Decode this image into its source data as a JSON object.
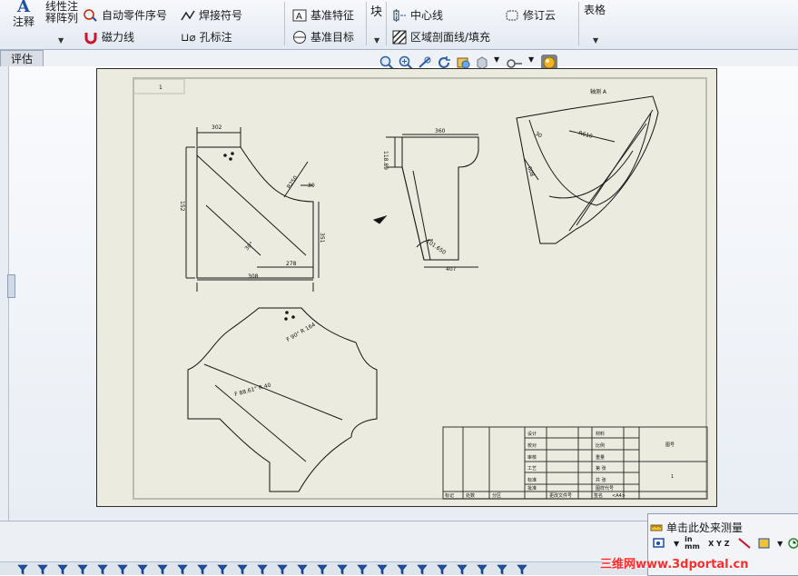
{
  "ribbon": {
    "annotation_label": "注释",
    "linear_note_label_1": "线性注",
    "linear_note_label_2": "释阵列",
    "auto_balloon": "自动零件序号",
    "magnetic_line": "磁力线",
    "weld_symbol": "焊接符号",
    "hole_callout": "孔标注",
    "datum_feature": "基准特征",
    "datum_target": "基准目标",
    "block_label": "块",
    "centerline": "中心线",
    "area_hatch": "区域剖面线/填充",
    "revision_cloud": "修订云",
    "tables_label": "表格"
  },
  "tabs": {
    "evaluate": "评估"
  },
  "drawing": {
    "sheet_label": "1",
    "view_note": "轴测 A",
    "top_view_dims": [
      "302",
      "152",
      "R250",
      "30",
      "351",
      "278",
      "308",
      "30°"
    ],
    "side_view_dims": [
      "360",
      "118.89",
      "101.650",
      "407"
    ],
    "iso_view_dims": [
      "30",
      "R610",
      "608"
    ],
    "flat_view_labels": [
      "F 90° R 164",
      "F 88.61° R 40"
    ],
    "title_block": {
      "labels": [
        "设计",
        "校对",
        "审核",
        "工艺",
        "标准",
        "批准"
      ],
      "mid": [
        "材料",
        "比例",
        "重量",
        "第 张",
        "共 张",
        "图样代号"
      ],
      "right_top": "图号",
      "bottom_row": [
        "标记",
        "处数",
        "分区",
        "更改文件号",
        "签名",
        "年月日"
      ],
      "bottom_text": "<A4>",
      "right_num": "1"
    }
  },
  "measure_panel": {
    "title": "单击此处来测量",
    "unit_label": "in mm",
    "xyz_label": "X Y Z"
  },
  "watermark": "三维网www.3dportal.cn"
}
